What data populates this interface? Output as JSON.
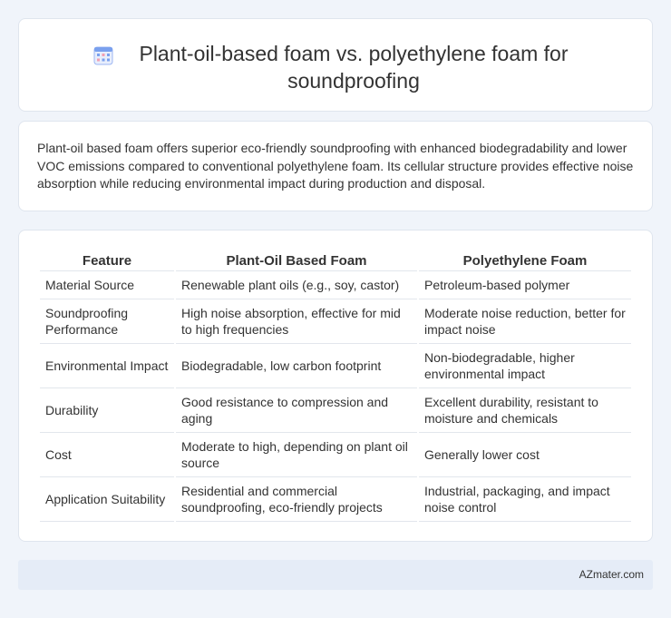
{
  "header": {
    "title": "Plant-oil-based foam vs. polyethylene foam for soundproofing",
    "icon": "calendar-grid-icon"
  },
  "summary": {
    "text": "Plant-oil based foam offers superior eco-friendly soundproofing with enhanced biodegradability and lower VOC emissions compared to conventional polyethylene foam. Its cellular structure provides effective noise absorption while reducing environmental impact during production and disposal."
  },
  "table": {
    "headers": [
      "Feature",
      "Plant-Oil Based Foam",
      "Polyethylene Foam"
    ],
    "rows": [
      [
        "Material Source",
        "Renewable plant oils (e.g., soy, castor)",
        "Petroleum-based polymer"
      ],
      [
        "Soundproofing Performance",
        "High noise absorption, effective for mid to high frequencies",
        "Moderate noise reduction, better for impact noise"
      ],
      [
        "Environmental Impact",
        "Biodegradable, low carbon footprint",
        "Non-biodegradable, higher environmental impact"
      ],
      [
        "Durability",
        "Good resistance to compression and aging",
        "Excellent durability, resistant to moisture and chemicals"
      ],
      [
        "Cost",
        "Moderate to high, depending on plant oil source",
        "Generally lower cost"
      ],
      [
        "Application Suitability",
        "Residential and commercial soundproofing, eco-friendly projects",
        "Industrial, packaging, and impact noise control"
      ]
    ]
  },
  "footer": {
    "text": "AZmater.com"
  },
  "colors": {
    "background": "#f0f4fa",
    "card": "#ffffff",
    "footer": "#e5ecf7",
    "icon_accent": "#5b8def"
  }
}
